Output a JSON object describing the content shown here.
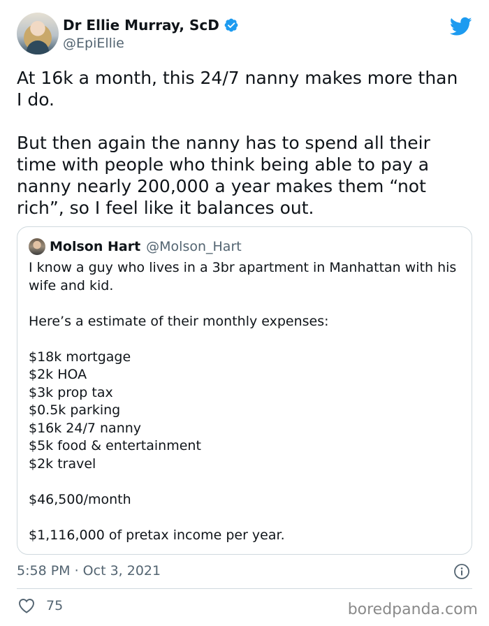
{
  "author": {
    "display_name": "Dr Ellie Murray, ScD",
    "handle": "@EpiEllie",
    "verified": true,
    "avatar_icon": "profile-photo"
  },
  "brand": {
    "icon": "twitter-bird-icon",
    "color": "#1d9bf0"
  },
  "tweet": {
    "text": "At 16k a month, this 24/7 nanny makes more than\nI do.\n\nBut then again the nanny has to spend all their\ntime with people who think being able to pay a\nnanny nearly 200,000 a year makes them “not\nrich”, so I feel like it balances out."
  },
  "quoted_tweet": {
    "display_name": "Molson Hart",
    "handle": "@Molson_Hart",
    "text": "I know a guy who lives in a 3br apartment in Manhattan with his\nwife and kid.\n\nHere’s a estimate of their monthly expenses:\n\n$18k mortgage\n$2k HOA\n$3k prop tax\n$0.5k parking\n$16k 24/7 nanny\n$5k food & entertainment\n$2k travel\n\n$46,500/month\n\n$1,116,000 of pretax income per year."
  },
  "meta": {
    "timestamp": "5:58 PM · Oct 3, 2021",
    "like_count": "75"
  },
  "watermark": "boredpanda.com",
  "colors": {
    "text": "#0f1419",
    "secondary": "#536471",
    "border": "#cfd9de",
    "verified_blue": "#1d9bf0"
  }
}
